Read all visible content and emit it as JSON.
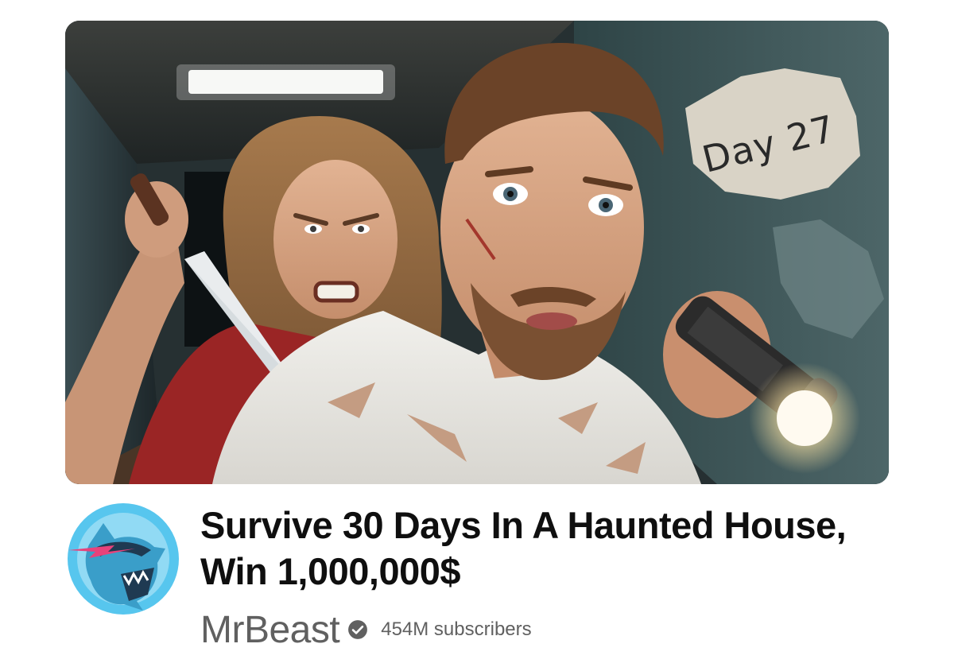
{
  "video": {
    "thumbnail_overlay_text": "Day 27",
    "title_line1": "Survive 30 Days In A Haunted House,",
    "title_line2": "Win 1,000,000$"
  },
  "channel": {
    "name": "MrBeast",
    "subscribers": "454M subscribers",
    "verified": true,
    "avatar_icon": "panther-logo",
    "brand_color": "#57c6ee"
  },
  "colors": {
    "title": "#0f0f0f",
    "meta": "#606060"
  }
}
